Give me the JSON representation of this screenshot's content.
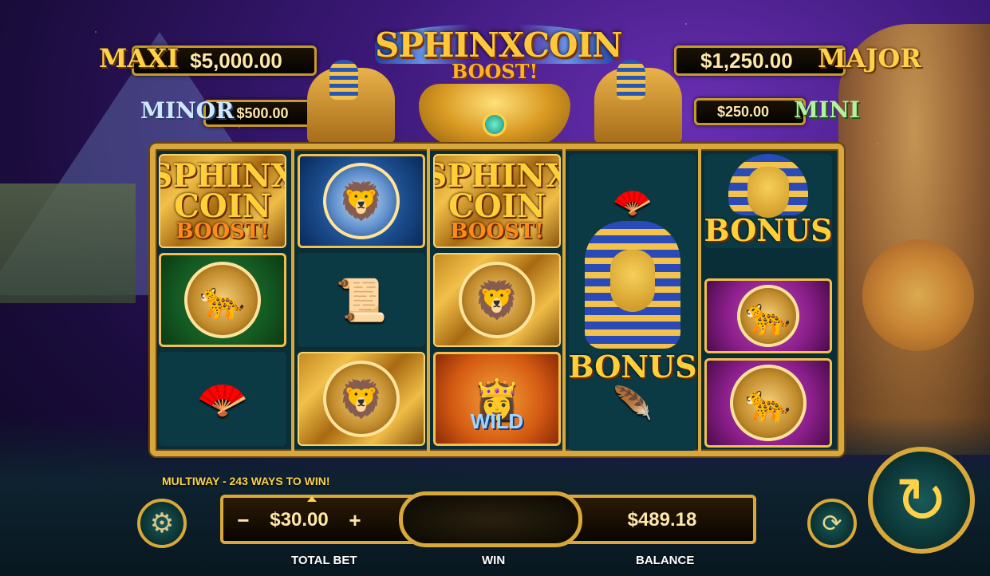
{
  "jackpots": {
    "maxi": {
      "label": "MAXI",
      "amount": "$5,000.00"
    },
    "minor": {
      "label": "MINOR",
      "amount": "$500.00"
    },
    "major": {
      "label": "MAJOR",
      "amount": "$1,250.00"
    },
    "mini": {
      "label": "MINI",
      "amount": "$250.00"
    }
  },
  "logo": {
    "line1": "SPHINXCOIN",
    "line2": "BOOST!"
  },
  "reels": {
    "sphinx_line1": "SPHINX",
    "sphinx_line2": "COIN",
    "sphinx_line3": "BOOST!",
    "bonus_label": "BONUS",
    "wild_label": "WILD"
  },
  "icons": {
    "settings": "gear-icon",
    "autoplay": "autoplay-icon",
    "spin": "spin-icon",
    "white_lion": "white-lion-icon",
    "leopard": "leopard-icon",
    "lion": "lion-icon",
    "cheetah": "cheetah-icon",
    "scroll": "scroll-icon",
    "fan": "fan-icon",
    "feather": "peacock-feather-icon",
    "pharaoh": "pharaoh-icon"
  },
  "panel": {
    "ways_text": "MULTIWAY - 243 WAYS TO WIN!",
    "bet_minus": "−",
    "bet_value": "$30.00",
    "bet_plus": "+",
    "total_bet_label": "TOTAL BET",
    "win_label": "WIN",
    "balance_value": "$489.18",
    "balance_label": "BALANCE"
  },
  "colors": {
    "gold": "#d9a83a",
    "reel_bg": "#0a2e38",
    "text_gold": "#ffe7a8"
  }
}
